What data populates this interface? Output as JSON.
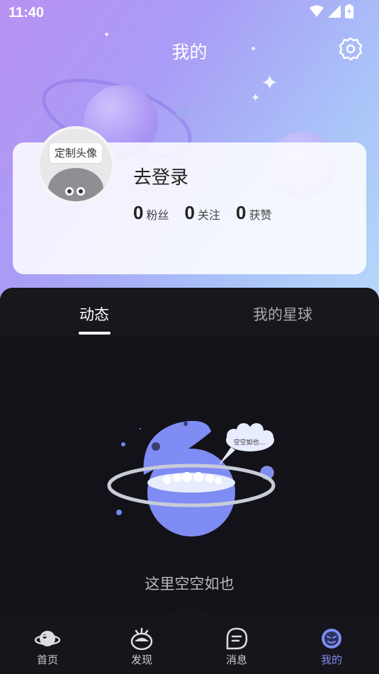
{
  "status_bar": {
    "time": "11:40"
  },
  "header": {
    "title": "我的"
  },
  "profile": {
    "avatar_tag": "定制头像",
    "login_label": "去登录",
    "stats": [
      {
        "value": "0",
        "label": "粉丝"
      },
      {
        "value": "0",
        "label": "关注"
      },
      {
        "value": "0",
        "label": "获赞"
      }
    ]
  },
  "tabs": [
    {
      "label": "动态",
      "active": true
    },
    {
      "label": "我的星球",
      "active": false
    }
  ],
  "empty_state": {
    "bubble_text": "空空如也...",
    "message": "这里空空如也"
  },
  "bottom_nav": [
    {
      "label": "首页",
      "icon": "planet-icon",
      "active": false
    },
    {
      "label": "发现",
      "icon": "discover-icon",
      "active": false
    },
    {
      "label": "消息",
      "icon": "message-icon",
      "active": false
    },
    {
      "label": "我的",
      "icon": "profile-face-icon",
      "active": true
    }
  ],
  "colors": {
    "accent": "#7f8cf3",
    "background": "#0f0f14"
  }
}
